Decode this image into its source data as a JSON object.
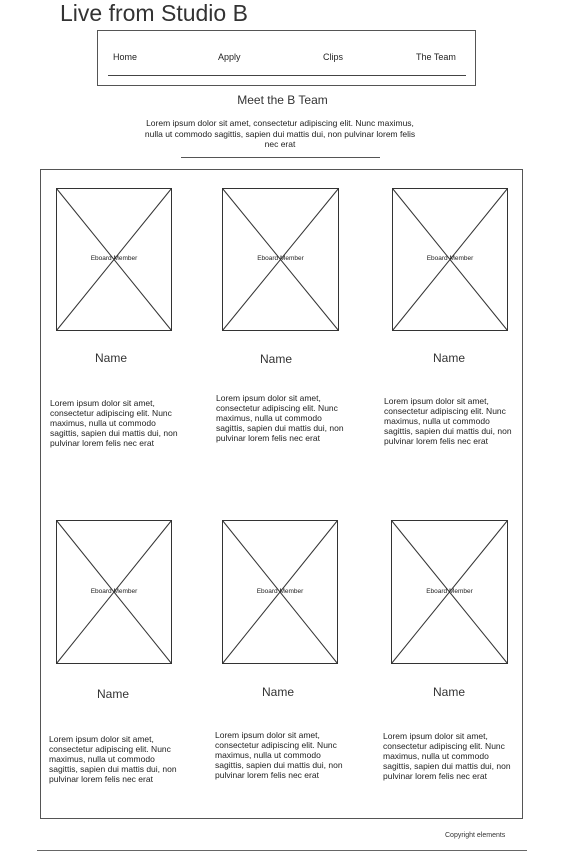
{
  "site": {
    "title": "Live from Studio B"
  },
  "nav": {
    "items": [
      {
        "label": "Home"
      },
      {
        "label": "Apply"
      },
      {
        "label": "Clips"
      },
      {
        "label": "The Team"
      }
    ]
  },
  "section": {
    "title": "Meet the B Team",
    "intro": "Lorem ipsum dolor sit amet, consectetur adipiscing elit. Nunc maximus, nulla ut commodo sagittis, sapien dui mattis dui, non pulvinar lorem felis nec erat"
  },
  "members": [
    {
      "photo_label": "Eboard Member",
      "name": "Name",
      "bio": "Lorem ipsum dolor sit amet, consectetur adipiscing elit. Nunc maximus, nulla ut commodo sagittis, sapien dui mattis dui, non pulvinar lorem felis nec erat"
    },
    {
      "photo_label": "Eboard Member",
      "name": "Name",
      "bio": "Lorem ipsum dolor sit amet, consectetur adipiscing elit. Nunc maximus, nulla ut commodo sagittis, sapien dui mattis dui, non pulvinar lorem felis nec erat"
    },
    {
      "photo_label": "Eboard Member",
      "name": "Name",
      "bio": "Lorem ipsum dolor sit amet, consectetur adipiscing elit. Nunc maximus, nulla ut commodo sagittis, sapien dui mattis dui, non pulvinar lorem felis nec erat"
    },
    {
      "photo_label": "Eboard Member",
      "name": "Name",
      "bio": "Lorem ipsum dolor sit amet, consectetur adipiscing elit. Nunc maximus, nulla ut commodo sagittis, sapien dui mattis dui, non pulvinar lorem felis nec erat"
    },
    {
      "photo_label": "Eboard Member",
      "name": "Name",
      "bio": "Lorem ipsum dolor sit amet, consectetur adipiscing elit. Nunc maximus, nulla ut commodo sagittis, sapien dui mattis dui, non pulvinar lorem felis nec erat"
    },
    {
      "photo_label": "Eboard Member",
      "name": "Name",
      "bio": "Lorem ipsum dolor sit amet, consectetur adipiscing elit. Nunc maximus, nulla ut commodo sagittis, sapien dui mattis dui, non pulvinar lorem felis nec erat"
    }
  ],
  "footer": {
    "copyright": "Copyright elements"
  }
}
